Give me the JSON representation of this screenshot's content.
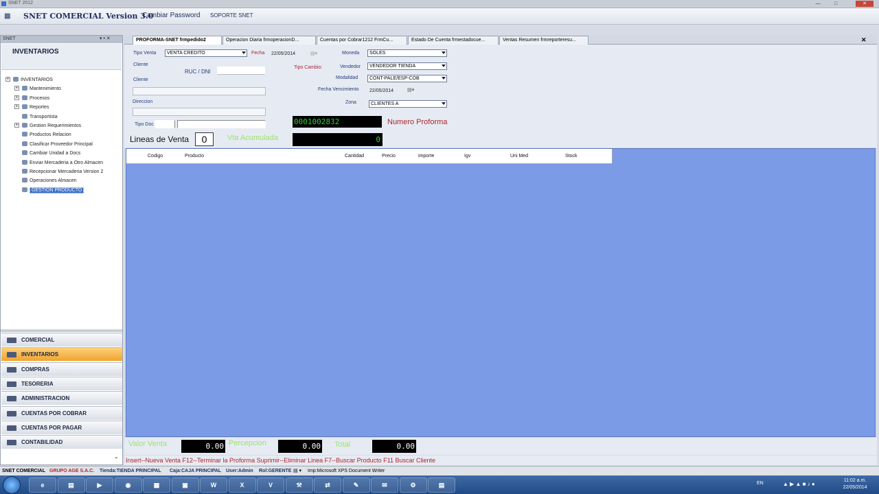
{
  "window": {
    "title": "SNET 2012"
  },
  "menu": {
    "app_title": "SNET COMERCIAL Version 3.0",
    "change_password": "Cambiar Password",
    "support": "SOPORTE SNET"
  },
  "left_panel": {
    "header": "SNET",
    "title": "INVENTARIOS",
    "tree": [
      {
        "label": "INVENTARIOS",
        "expandable": true,
        "level": 0
      },
      {
        "label": "Mantenimiento",
        "expandable": true,
        "level": 1
      },
      {
        "label": "Procesos",
        "expandable": true,
        "level": 1
      },
      {
        "label": "Reportes",
        "expandable": true,
        "level": 1
      },
      {
        "label": "Transportista",
        "expandable": false,
        "level": 1
      },
      {
        "label": "Gestion Requerimientos",
        "expandable": true,
        "level": 1
      },
      {
        "label": "Productos Relacion",
        "expandable": false,
        "level": 1
      },
      {
        "label": "Clasificar Proveedor Principal",
        "expandable": false,
        "level": 1
      },
      {
        "label": "Cambiar Unidad a Docs",
        "expandable": false,
        "level": 1
      },
      {
        "label": "Enviar Mercaderia a Otro Almacen",
        "expandable": false,
        "level": 1
      },
      {
        "label": "Recepcionar Mercaderia Version 2",
        "expandable": false,
        "level": 1
      },
      {
        "label": "Operaciones Almacen",
        "expandable": false,
        "level": 1
      },
      {
        "label": "GESTION PRODUCTO",
        "expandable": false,
        "level": 1,
        "selected": true
      }
    ],
    "nav": [
      {
        "label": "COMERCIAL",
        "active": false
      },
      {
        "label": "INVENTARIOS",
        "active": true
      },
      {
        "label": "COMPRAS",
        "active": false
      },
      {
        "label": "TESORERIA",
        "active": false
      },
      {
        "label": "ADMINISTRACION",
        "active": false
      },
      {
        "label": "CUENTAS POR COBRAR",
        "active": false
      },
      {
        "label": "CUENTAS POR PAGAR",
        "active": false
      },
      {
        "label": "CONTABILIDAD",
        "active": false
      }
    ]
  },
  "tabs": [
    "PROFORMA-SNET frmpedido2",
    "Operacion Diaria frmoperacionD...",
    "Cuentas por Cobrar1212 FrmCu...",
    "Estado De Cuenta frmestadocue...",
    "Ventas Resumen frmreporteresu..."
  ],
  "form": {
    "tipo_venta_label": "Tipo Venta",
    "tipo_venta_value": "VENTA CREDITO",
    "fecha_label": "Fecha",
    "fecha_value": "22/05/2014",
    "cliente_label": "Cliente",
    "ruc_label": "RUC / DNI",
    "cliente2_label": "Cliente",
    "direccion_label": "Direccion",
    "tipo_doc_label": "Tipo Doc",
    "tipo_cambio_label": "Tipo Cambio:",
    "moneda_label": "Moneda",
    "moneda_value": "SOLES",
    "vendedor_label": "Vendedor",
    "vendedor_value": "VENDEDOR TIENDA",
    "modalidad_label": "Modalidad",
    "modalidad_value": "CONT-PALE/ESP-COB",
    "fecha_venc_label": "Fecha Vencimiento",
    "fecha_venc_value": "22/05/2014",
    "zona_label": "Zona",
    "zona_value": "CLIENTES A",
    "proforma_number": "0001002832",
    "proforma_label": "Numero Proforma",
    "lineas_label": "Lineas de Venta",
    "lineas_value": "0",
    "vta_acumulada_label": "Vta Acumulada",
    "vta_acumulada_value": "0"
  },
  "grid_columns": [
    "Codigo",
    "Producto",
    "Cantidad",
    "Precio",
    "importe",
    "Igv",
    "Uni Med",
    "Stock"
  ],
  "totals": {
    "valor_venta_label": "Valor Venta",
    "valor_venta_value": "0.00",
    "percepcion_label": "Percepcion",
    "percepcion_value": "0.00",
    "total_label": "Total",
    "total_value": "0.00"
  },
  "shortcuts": "Insert--Nueva Venta  F12--Terminar la Proforma  Suprimir--Eliminar Linea  F7--Buscar Producto  F11 Buscar Cliente",
  "status": {
    "app": "SNET COMERCIAL",
    "company": "GRUPO AGE S.A.C.",
    "store": "Tienda:TIENDA PRINCIPAL",
    "cash": "Caja:CAJA PRINCIPAL",
    "user": "User:Admin",
    "role": "Rol:GERENTE",
    "printer": "Imp:Microsoft XPS Document Writer"
  },
  "taskbar": {
    "lang": "EN",
    "time": "11:02 a.m.",
    "date": "22/05/2014",
    "apps": [
      "ie-icon",
      "explorer-icon",
      "media-icon",
      "chrome-icon",
      "app-icon",
      "network-icon",
      "word-icon",
      "excel-icon",
      "visual-studio-icon",
      "tools-icon",
      "teamviewer-icon",
      "notepad-icon",
      "mail-icon",
      "tool2-icon",
      "folder-icon"
    ]
  }
}
